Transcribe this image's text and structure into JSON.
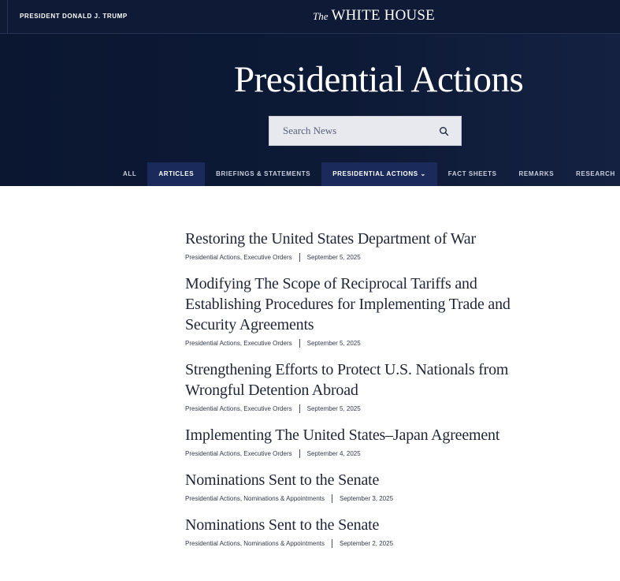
{
  "topbar": {
    "president_label": "PRESIDENT DONALD J. TRUMP",
    "logo_the": "The",
    "logo_name": "WHITE HOUSE"
  },
  "hero": {
    "title": "Presidential Actions",
    "search_placeholder": "Search News",
    "search_icon": "search-icon"
  },
  "tabs": [
    {
      "label": "ALL",
      "active": false
    },
    {
      "label": "ARTICLES",
      "active": true
    },
    {
      "label": "BRIEFINGS & STATEMENTS",
      "active": false
    },
    {
      "label": "PRESIDENTIAL ACTIONS ⌄",
      "active": true
    },
    {
      "label": "FACT SHEETS",
      "active": false
    },
    {
      "label": "REMARKS",
      "active": false
    },
    {
      "label": "RESEARCH",
      "active": false
    }
  ],
  "articles": [
    {
      "title": "Restoring the United States Department of War",
      "categories": "Presidential Actions, Executive Orders",
      "date": "September 5, 2025"
    },
    {
      "title": "Modifying The Scope of Reciprocal Tariffs and Establishing Procedures for Implementing Trade and Security Agreements",
      "categories": "Presidential Actions, Executive Orders",
      "date": "September 5, 2025"
    },
    {
      "title": "Strengthening Efforts to Protect U.S. Nationals from Wrongful Detention Abroad",
      "categories": "Presidential Actions, Executive Orders",
      "date": "September 5, 2025"
    },
    {
      "title": "Implementing The United States–Japan Agreement",
      "categories": "Presidential Actions, Executive Orders",
      "date": "September 4, 2025"
    },
    {
      "title": "Nominations Sent to the Senate",
      "categories": "Presidential Actions, Nominations & Appointments",
      "date": "September 3, 2025"
    },
    {
      "title": "Nominations Sent to the Senate",
      "categories": "Presidential Actions, Nominations & Appointments",
      "date": "September 2, 2025"
    }
  ],
  "colors": {
    "header_bg": "#0f1a36",
    "active_tab_bg": "#1a2a5a",
    "search_bg": "#e7e9ef"
  }
}
